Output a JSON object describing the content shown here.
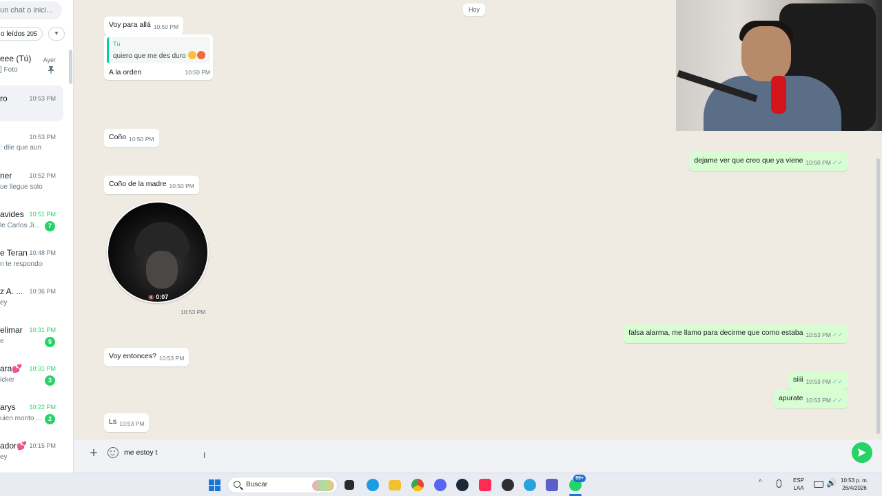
{
  "sidebar": {
    "search_placeholder": "un chat o inici...",
    "filter_label": "o leídos",
    "filter_count": "205",
    "filter_dropdown": "▼",
    "pin_icon": "pin-icon",
    "chats": [
      {
        "name": "eee (Tú)",
        "time": "Ayer",
        "preview": "] Foto",
        "badge": "",
        "pinned": true,
        "active": false
      },
      {
        "name": "ro",
        "time": "10:53 PM",
        "preview": "",
        "badge": "",
        "pinned": false,
        "active": true
      },
      {
        "name": "",
        "time": "10:53 PM",
        "preview": ": dile que aun ...",
        "badge": "",
        "pinned": false,
        "active": false
      },
      {
        "name": "ner",
        "time": "10:52 PM",
        "preview": "ue llegue solo",
        "badge": "",
        "pinned": false,
        "active": false
      },
      {
        "name": "avides",
        "time": "10:51 PM",
        "preview": "le Carlos Ji...",
        "badge": "7",
        "pinned": false,
        "active": false
      },
      {
        "name": "e Teran",
        "time": "10:48 PM",
        "preview": "n te respondooo",
        "badge": "",
        "pinned": false,
        "active": false
      },
      {
        "name": "z A. ...",
        "time": "10:36 PM",
        "preview": "ey",
        "badge": "",
        "pinned": false,
        "active": false
      },
      {
        "name": "elimar",
        "time": "10:31 PM",
        "preview": "e",
        "badge": "5",
        "pinned": false,
        "active": false
      },
      {
        "name": "ara💕",
        "time": "10:31 PM",
        "preview": "icker",
        "badge": "3",
        "pinned": false,
        "active": false
      },
      {
        "name": "arys",
        "time": "10:22 PM",
        "preview": "uien monto ...",
        "badge": "2",
        "pinned": false,
        "active": false
      },
      {
        "name": "ador💕",
        "time": "10:15 PM",
        "preview": "ey",
        "badge": "",
        "pinned": false,
        "active": false
      }
    ]
  },
  "conversation": {
    "day_separator": "Hoy",
    "messages": {
      "m1": {
        "text": "Voy para allá",
        "time": "10:50 PM"
      },
      "m2": {
        "quote_author": "Tú",
        "quote_text": "quiero que me des duro",
        "text": "A la orden",
        "time": "10:50 PM"
      },
      "m3": {
        "text": "Coño",
        "time": "10:50 PM"
      },
      "m4": {
        "text": "Coño de la madre",
        "time": "10:50 PM"
      },
      "m5": {
        "video_duration": "0:07",
        "time": "10:53 PM"
      },
      "m6": {
        "text": "Voy entonces?",
        "time": "10:53 PM"
      },
      "m7": {
        "text": "Ls",
        "time": "10:53 PM"
      },
      "o1": {
        "text": "dejame ver que creo que ya viene",
        "time": "10:50 PM"
      },
      "o2": {
        "text": "falsa alarma, me llamo para decirme que como estaba",
        "time": "10:53 PM"
      },
      "o3": {
        "text": "siiii",
        "time": "10:53 PM"
      },
      "o4": {
        "text": "apurate",
        "time": "10:53 PM"
      }
    },
    "read_ticks": "✓✓"
  },
  "composer": {
    "attach_icon": "plus-icon",
    "plus_glyph": "+",
    "sticker_icon": "sticker-icon",
    "input_value": "me estoy t",
    "text_cursor": "I",
    "send_icon": "send-icon"
  },
  "taskbar": {
    "search_label": "Buscar",
    "notification_badge": "99+",
    "tray_chevron": "^",
    "language_line1": "ESP",
    "language_line2": "LAA",
    "volume_glyph": "🔊",
    "clock_time": "10:53 p. m.",
    "clock_date": "26/4/2026",
    "icons": [
      "windows-icon",
      "search-icon",
      "task-view-icon",
      "edge-icon",
      "file-explorer-icon",
      "chrome-icon",
      "discord-icon",
      "steam-icon",
      "tiktok-icon",
      "obs-icon",
      "telegram-icon",
      "teams-icon",
      "whatsapp-icon"
    ],
    "colors": {
      "windows": "#1778d6",
      "task_view": "#2b2b2b",
      "edge": "#1b9be0",
      "file_explorer": "#f2c12e",
      "chrome": "#e94235",
      "discord": "#5865f2",
      "steam": "#1b2838",
      "tiktok": "#fe2c55",
      "obs": "#302e31",
      "telegram": "#2aa3dd",
      "teams": "#5b5fc7",
      "whatsapp": "#25d366"
    }
  },
  "colors": {
    "accent_green": "#25d366",
    "outgoing_bubble": "#d9fdd3",
    "incoming_bubble": "#ffffff",
    "chat_background": "#efeae2",
    "read_tick_blue": "#53bdeb"
  }
}
